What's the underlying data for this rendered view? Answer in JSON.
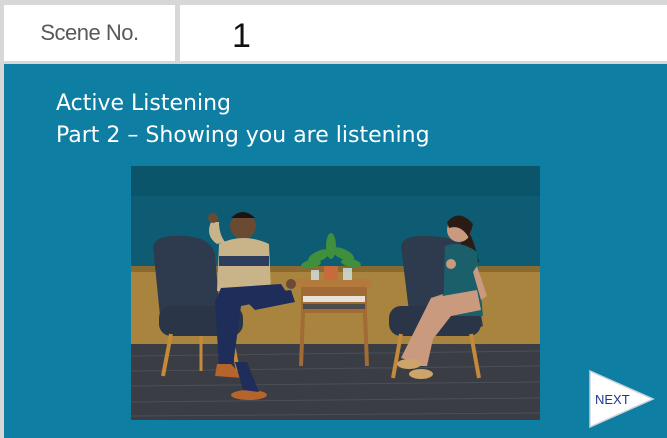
{
  "header": {
    "scene_label": "Scene No.",
    "scene_number": "1"
  },
  "slide": {
    "title_line_1": "Active Listening",
    "title_line_2": "Part 2 – Showing you are listening",
    "background_color": "#0f7ea3"
  },
  "navigation": {
    "next_label": "NEXT"
  }
}
